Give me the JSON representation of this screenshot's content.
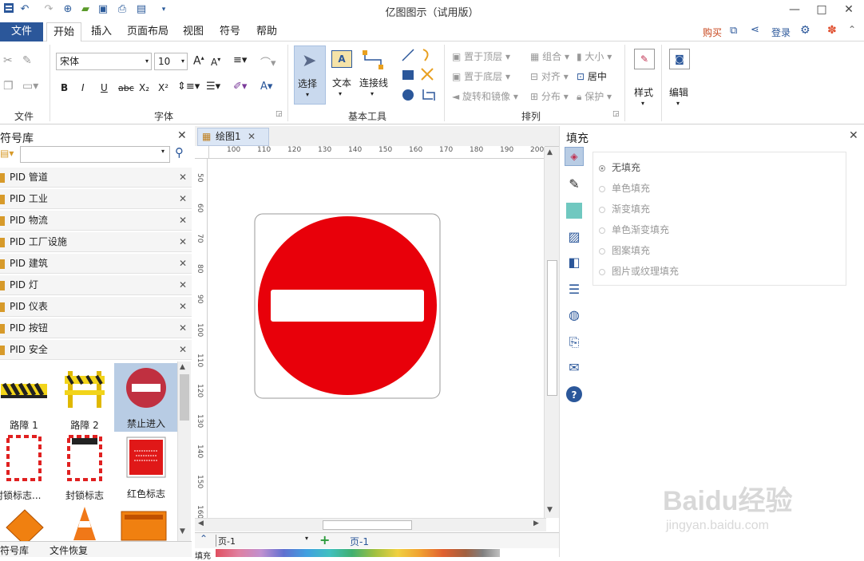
{
  "app": {
    "title": "亿图图示（试用版）"
  },
  "window_controls": {
    "minimize": "—",
    "maximize": "□",
    "close": "✕"
  },
  "menu": {
    "file": "文件",
    "tabs": [
      "开始",
      "插入",
      "页面布局",
      "视图",
      "符号",
      "帮助"
    ],
    "buy": "购买",
    "login": "登录"
  },
  "ribbon": {
    "groups": {
      "file": "文件",
      "font": "字体",
      "basic_tools": "基本工具",
      "arrange": "排列"
    },
    "font_name": "宋体",
    "font_size": "10",
    "format_buttons": [
      "B",
      "I",
      "U",
      "abc",
      "X₂",
      "X²"
    ],
    "tools": {
      "select": "选择",
      "text": "文本",
      "connector": "连接线"
    },
    "arrange": {
      "bring_top": "置于顶层",
      "send_bottom": "置于底层",
      "rotate_mirror": "旋转和镜像",
      "group": "组合",
      "align": "对齐",
      "distribute": "分布",
      "size": "大小",
      "center": "居中",
      "protect": "保护"
    },
    "style": "样式",
    "edit": "编辑"
  },
  "symbol_library": {
    "title": "符号库",
    "search_placeholder": "",
    "categories": [
      "PID 管道",
      "PID 工业",
      "PID 物流",
      "PID 工厂设施",
      "PID 建筑",
      "PID 灯",
      "PID 仪表",
      "PID 按钮",
      "PID 安全"
    ],
    "symbols": [
      "路障 1",
      "路障 2",
      "禁止进入",
      "封锁标志...",
      "封锁标志",
      "红色标志"
    ],
    "bottom_tabs": [
      "符号库",
      "文件恢复"
    ]
  },
  "document": {
    "tab": "绘图1",
    "ruler_h": [
      "100",
      "110",
      "120",
      "130",
      "140",
      "150",
      "160",
      "170",
      "180",
      "190",
      "200"
    ],
    "ruler_v": [
      "50",
      "60",
      "70",
      "80",
      "90",
      "100",
      "110",
      "120",
      "130",
      "140",
      "150",
      "160"
    ],
    "page_select": "页-1",
    "page_tab": "页-1",
    "fill_label": "填充"
  },
  "fill_panel": {
    "title": "填充",
    "options": [
      "无填充",
      "单色填充",
      "渐变填充",
      "单色渐变填充",
      "图案填充",
      "图片或纹理填充"
    ]
  },
  "watermark": {
    "brand": "Baidu经验",
    "url": "jingyan.baidu.com"
  },
  "colors": {
    "accent": "#2b579a",
    "sign_red": "#e8000a",
    "selected_bg": "#b8cce4"
  }
}
